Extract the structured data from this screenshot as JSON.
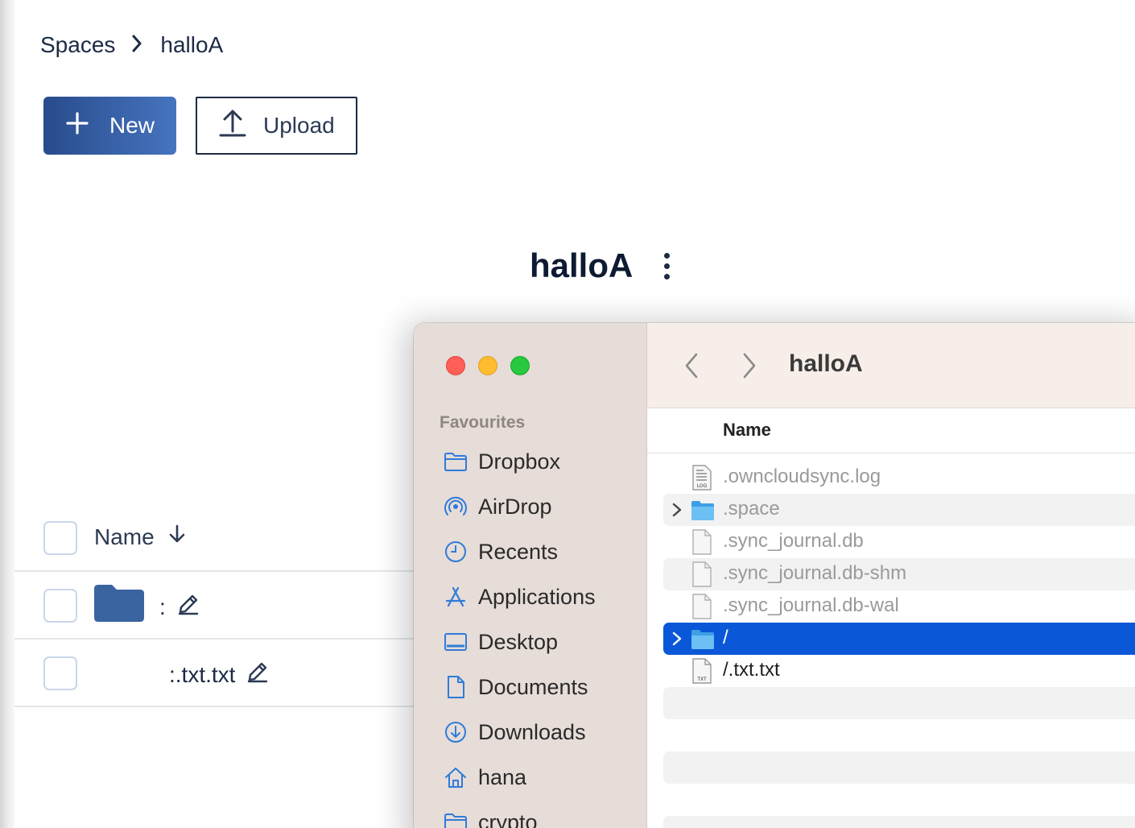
{
  "breadcrumb": {
    "root": "Spaces",
    "current": "halloA"
  },
  "actions": {
    "new_label": "New",
    "upload_label": "Upload"
  },
  "space": {
    "title": "halloA"
  },
  "table": {
    "name_header": "Name",
    "rows": [
      {
        "name": ":",
        "type": "folder"
      },
      {
        "name": ":.txt.txt",
        "type": "file"
      }
    ]
  },
  "finder": {
    "title": "halloA",
    "favourites_label": "Favourites",
    "sidebar": [
      {
        "label": "Dropbox",
        "icon": "folder-icon"
      },
      {
        "label": "AirDrop",
        "icon": "airdrop-icon"
      },
      {
        "label": "Recents",
        "icon": "clock-icon"
      },
      {
        "label": "Applications",
        "icon": "applications-icon"
      },
      {
        "label": "Desktop",
        "icon": "desktop-icon"
      },
      {
        "label": "Documents",
        "icon": "document-icon"
      },
      {
        "label": "Downloads",
        "icon": "download-icon"
      },
      {
        "label": "hana",
        "icon": "home-icon"
      },
      {
        "label": "crypto",
        "icon": "folder-icon"
      }
    ],
    "column_name": "Name",
    "files": [
      {
        "name": ".owncloudsync.log",
        "kind": "log",
        "hidden": true
      },
      {
        "name": ".space",
        "kind": "folder",
        "hidden": true
      },
      {
        "name": ".sync_journal.db",
        "kind": "doc",
        "hidden": true
      },
      {
        "name": ".sync_journal.db-shm",
        "kind": "doc",
        "hidden": true
      },
      {
        "name": ".sync_journal.db-wal",
        "kind": "doc",
        "hidden": true
      },
      {
        "name": "/",
        "kind": "folder",
        "hidden": false,
        "selected": true
      },
      {
        "name": "/.txt.txt",
        "kind": "txt",
        "hidden": false
      }
    ]
  },
  "colors": {
    "primary_button": "#3a64ad",
    "text_dark": "#1c2a44",
    "selection": "#0a57d8",
    "web_folder": "#3a64a0",
    "finder_folder": "#5ab4f0"
  }
}
